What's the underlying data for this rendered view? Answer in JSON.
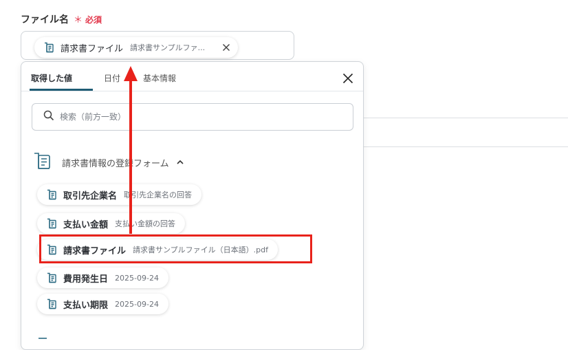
{
  "field": {
    "label": "ファイル名",
    "required_mark": "＊",
    "required_text": "必須",
    "selected_chip": {
      "name": "請求書ファイル",
      "value": "請求書サンプルファ..."
    }
  },
  "dropdown": {
    "tabs": [
      {
        "label": "取得した値",
        "active": true
      },
      {
        "label": "日付",
        "active": false
      },
      {
        "label": "基本情報",
        "active": false
      }
    ],
    "search": {
      "placeholder": "検索（前方一致）",
      "value": ""
    },
    "section": {
      "title": "請求書情報の登録フォーム",
      "expanded": true
    },
    "items": [
      {
        "name": "取引先企業名",
        "value": "取引先企業名の回答"
      },
      {
        "name": "支払い金額",
        "value": "支払い金額の回答"
      },
      {
        "name": "請求書ファイル",
        "value": "請求書サンプルファイル（日本語）.pdf",
        "highlighted": true
      },
      {
        "name": "費用発生日",
        "value": "2025-09-24"
      },
      {
        "name": "支払い期限",
        "value": "2025-09-24"
      }
    ]
  },
  "colors": {
    "accent": "#1f5d75",
    "required": "#e2374b",
    "annotation": "#e8221b",
    "icon": "#2b6a82"
  },
  "icons": [
    "doc-icon",
    "close-icon",
    "search-icon",
    "chevron-up-icon"
  ]
}
